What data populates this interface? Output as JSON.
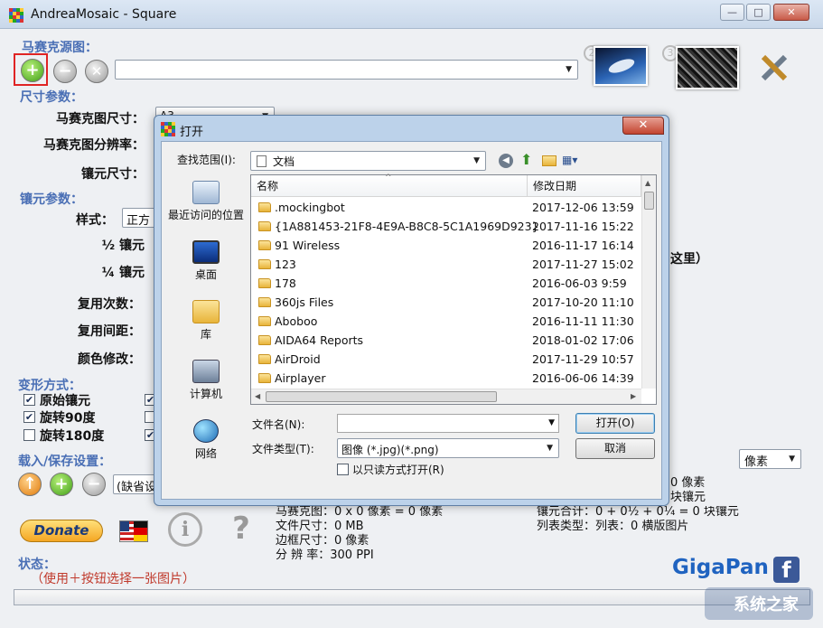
{
  "window": {
    "title": "AndreaMosaic - Square",
    "minimize": "—",
    "maximize": "□",
    "close": "✕"
  },
  "sections": {
    "source": "马赛克源图：",
    "size": "尺寸参数：",
    "tile": "镶元参数：",
    "transform": "变形方式：",
    "load_save": "载入/保存设置："
  },
  "size_params": {
    "mosaic_size_label": "马赛克图尺寸：",
    "mosaic_size_value": "A3",
    "resolution_label": "马赛克图分辨率：",
    "tile_size_label": "镶元尺寸："
  },
  "tile_params": {
    "style_label": "样式：",
    "style_value": "正方",
    "half_label": "½ 镶元",
    "quarter_label": "¼ 镶元",
    "repeat_label": "复用次数：",
    "spacing_label": "复用间距：",
    "color_label": "颜色修改：",
    "right_text": "这里）"
  },
  "transform_options": [
    {
      "label": "原始镶元",
      "checked": true
    },
    {
      "label": "旋转90度",
      "checked": true
    },
    {
      "label": "旋转180度",
      "checked": false
    }
  ],
  "load_save": {
    "preset_value": "(缺省设"
  },
  "unit_select": "像素",
  "info": {
    "mosaic_image": "马赛克图：0 x 0 像素 = 0 像素",
    "file_size": "文件尺寸：0 MB",
    "border_size": "边框尺寸：0 像素",
    "resolution": "分 辨 率：300 PPI",
    "right_1": "0 像素",
    "right_2": "块镶元",
    "right_3": "镶元合计：0 + 0½ + 0¼ = 0 块镶元",
    "right_4": "列表类型：列表：0 横版图片"
  },
  "status": {
    "label": "状态：",
    "text": "（使用＋按钮选择一张图片）"
  },
  "donate": "Donate",
  "info_symbol": "i",
  "help_symbol": "?",
  "gigapan": "GigaPan",
  "facebook_letter": "f",
  "watermark": "系统之家",
  "dialog": {
    "title": "打开",
    "close": "✕",
    "lookin_label": "查找范围(I):",
    "lookin_value": "文档",
    "places": [
      "最近访问的位置",
      "桌面",
      "库",
      "计算机",
      "网络"
    ],
    "columns": {
      "name": "名称",
      "date": "修改日期"
    },
    "files": [
      {
        "name": ".mockingbot",
        "date": "2017-12-06 13:59"
      },
      {
        "name": "{1A881453-21F8-4E9A-B8C8-5C1A1969D923}",
        "date": "2017-11-16 15:22"
      },
      {
        "name": "91 Wireless",
        "date": "2016-11-17 16:14"
      },
      {
        "name": "123",
        "date": "2017-11-27 15:02"
      },
      {
        "name": "178",
        "date": "2016-06-03 9:59"
      },
      {
        "name": "360js Files",
        "date": "2017-10-20 11:10"
      },
      {
        "name": "Aboboo",
        "date": "2016-11-11 11:30"
      },
      {
        "name": "AIDA64 Reports",
        "date": "2018-01-02 17:06"
      },
      {
        "name": "AirDroid",
        "date": "2017-11-29 10:57"
      },
      {
        "name": "Airplayer",
        "date": "2016-06-06 14:39"
      }
    ],
    "filename_label": "文件名(N):",
    "filename_value": "",
    "filetype_label": "文件类型(T):",
    "filetype_value": "图像 (*.jpg)(*.png)",
    "readonly_label": "以只读方式打开(R)",
    "open_button": "打开(O)",
    "cancel_button": "取消"
  }
}
